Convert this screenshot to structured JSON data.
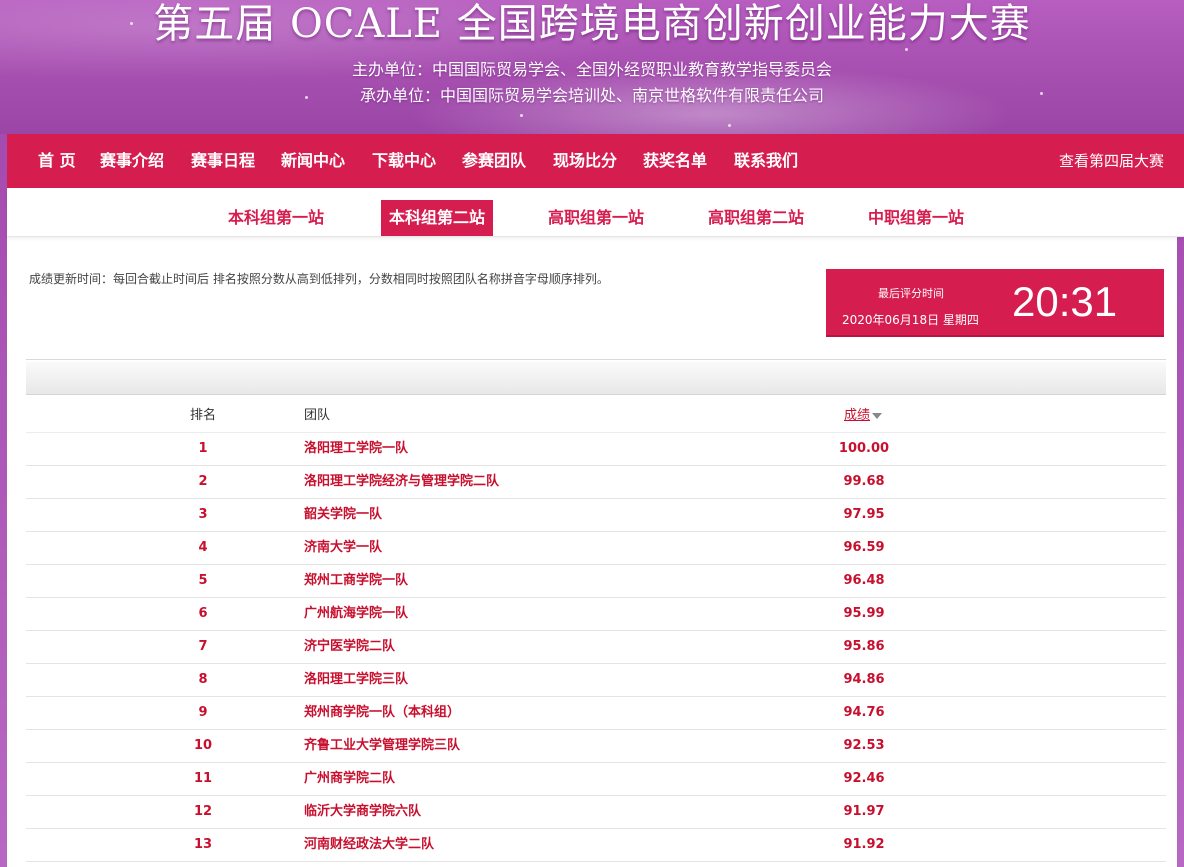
{
  "banner": {
    "title": "第五届 OCALE 全国跨境电商创新创业能力大赛",
    "organizer": "主办单位：中国国际贸易学会、全国外经贸职业教育教学指导委员会",
    "host": "承办单位：中国国际贸易学会培训处、南京世格软件有限责任公司"
  },
  "nav": {
    "items": [
      "首 页",
      "赛事介绍",
      "赛事日程",
      "新闻中心",
      "下载中心",
      "参赛团队",
      "现场比分",
      "获奖名单",
      "联系我们"
    ],
    "right_link": "查看第四届大赛",
    "accent_color": "#d61d4f"
  },
  "subtabs": {
    "items": [
      "本科组第一站",
      "本科组第二站",
      "高职组第一站",
      "高职组第二站",
      "中职组第一站"
    ],
    "active": "本科组第二站"
  },
  "info": {
    "update_note": "成绩更新时间：每回合截止时间后 排名按照分数从高到低排列，分数相同时按照团队名称拼音字母顺序排列。"
  },
  "timebox": {
    "label": "最后评分时间",
    "date": "2020年06月18日 星期四",
    "time": "20:31"
  },
  "table": {
    "headers": {
      "rank": "排名",
      "team": "团队",
      "score": "成绩"
    },
    "sort_icon": "sort-desc-icon",
    "rows": [
      {
        "rank": "1",
        "team": "洛阳理工学院一队",
        "score": "100.00"
      },
      {
        "rank": "2",
        "team": "洛阳理工学院经济与管理学院二队",
        "score": "99.68"
      },
      {
        "rank": "3",
        "team": "韶关学院一队",
        "score": "97.95"
      },
      {
        "rank": "4",
        "team": "济南大学一队",
        "score": "96.59"
      },
      {
        "rank": "5",
        "team": "郑州工商学院一队",
        "score": "96.48"
      },
      {
        "rank": "6",
        "team": "广州航海学院一队",
        "score": "95.99"
      },
      {
        "rank": "7",
        "team": "济宁医学院二队",
        "score": "95.86"
      },
      {
        "rank": "8",
        "team": "洛阳理工学院三队",
        "score": "94.86"
      },
      {
        "rank": "9",
        "team": "郑州商学院一队（本科组）",
        "score": "94.76"
      },
      {
        "rank": "10",
        "team": "齐鲁工业大学管理学院三队",
        "score": "92.53"
      },
      {
        "rank": "11",
        "team": "广州商学院二队",
        "score": "92.46"
      },
      {
        "rank": "12",
        "team": "临沂大学商学院六队",
        "score": "91.97"
      },
      {
        "rank": "13",
        "team": "河南财经政法大学二队",
        "score": "91.92"
      }
    ]
  }
}
